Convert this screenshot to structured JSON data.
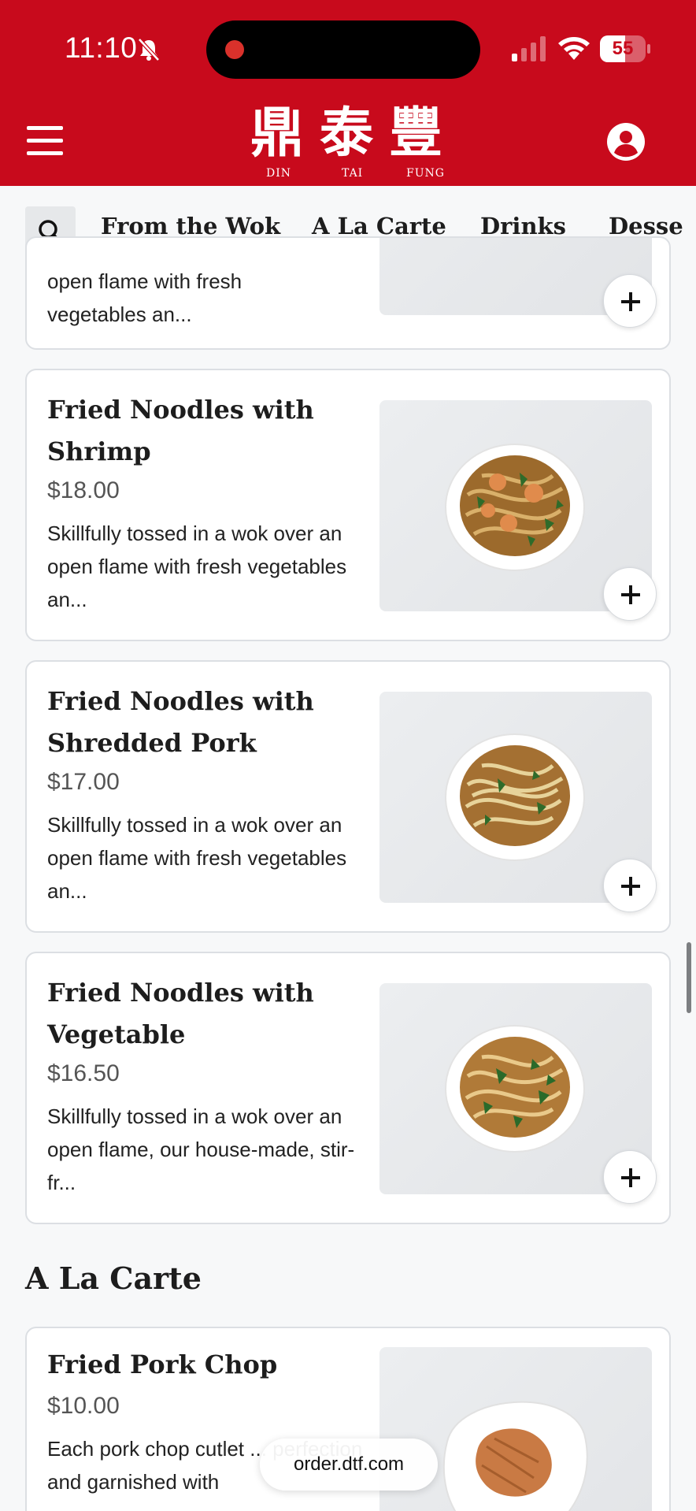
{
  "status_bar": {
    "time": "11:10",
    "battery_percent": "55",
    "battery_level": 0.55
  },
  "header": {
    "logo_glyphs": [
      "鼎",
      "泰",
      "豐"
    ],
    "logo_latin": [
      "DIN",
      "TAI",
      "FUNG"
    ]
  },
  "tabs": [
    {
      "label": "From the Wok",
      "active": true
    },
    {
      "label": "A La Carte",
      "active": false
    },
    {
      "label": "Drinks",
      "active": false
    },
    {
      "label": "Desse",
      "active": false
    }
  ],
  "partial_card": {
    "desc": "open flame with fresh\nvegetables an..."
  },
  "items": [
    {
      "title": "Fried Noodles with Shrimp",
      "price": "$18.00",
      "desc": "Skillfully tossed in a wok over an open flame with fresh vegetables an..."
    },
    {
      "title": "Fried Noodles with Shredded Pork",
      "price": "$17.00",
      "desc": "Skillfully tossed in a wok over an open flame with fresh vegetables an..."
    },
    {
      "title": "Fried Noodles with Vegetable",
      "price": "$16.50",
      "desc": "Skillfully tossed in a wok over an open flame, our house-made, stir-fr..."
    }
  ],
  "section": {
    "title": "A La Carte"
  },
  "a_la_carte_items": [
    {
      "title": "Fried Pork Chop",
      "price": "$10.00",
      "desc": "Each pork chop cutlet ... perfection and garnished with"
    }
  ],
  "browser": {
    "url": "order.dtf.com"
  },
  "colors": {
    "brand_red": "#c80a1c",
    "card_border": "#dcdfe3",
    "page_bg": "#f7f8f9"
  }
}
